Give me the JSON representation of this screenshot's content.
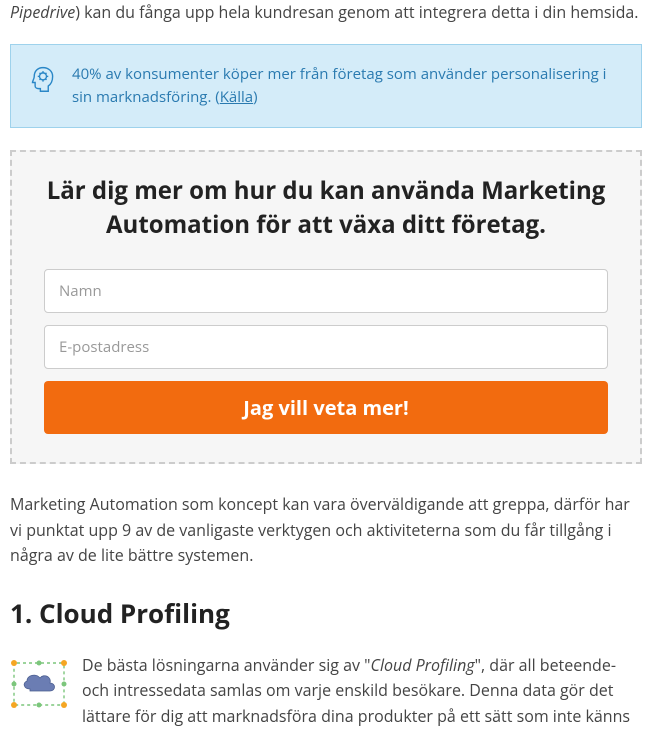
{
  "intro": {
    "italic_word": "Pipedrive",
    "rest": ") kan du fånga upp hela kundresan genom att integrera detta i din hemsida."
  },
  "callout": {
    "text_before_link": "40% av konsumenter köper mer från företag som använder personalisering i sin marknadsföring. (",
    "link_text": "Källa",
    "text_after_link": ")"
  },
  "form": {
    "heading": "Lär dig mer om hur du kan använda Marketing Automation för att växa ditt företag.",
    "name_placeholder": "Namn",
    "email_placeholder": "E-postadress",
    "button_label": "Jag vill veta mer!"
  },
  "middle_paragraph": "Marketing Automation som koncept kan vara överväldigande att greppa, därför har vi punktat upp 9 av de vanligaste verktygen och aktiviteterna som du får tillgång i några av de lite bättre systemen.",
  "section": {
    "heading": "1. Cloud Profiling",
    "text_before_quote": "De bästa lösningarna använder sig av \"",
    "italic_term": "Cloud Profiling",
    "text_after_quote": "\", där all beteende- och intressedata samlas om varje enskild besökare. Denna data gör det lättare för dig att marknadsföra dina produkter på ett sätt som inte känns"
  }
}
